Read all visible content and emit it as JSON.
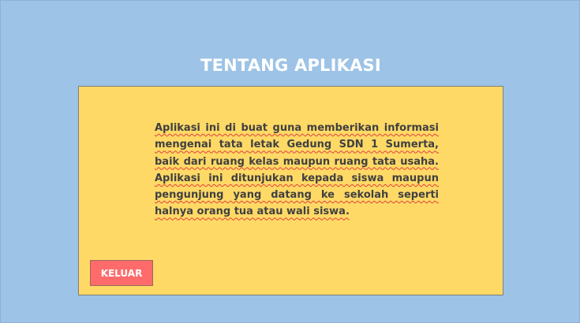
{
  "header": {
    "title": "TENTANG APLIKASI"
  },
  "content": {
    "description": "Aplikasi ini di buat guna memberikan informasi mengenai tata letak Gedung SDN 1 Sumerta, baik dari ruang kelas maupun ruang tata usaha. Aplikasi ini ditunjukan kepada siswa maupun pengunjung yang datang ke sekolah seperti halnya orang tua atau wali siswa."
  },
  "actions": {
    "exit_label": "KELUAR"
  },
  "colors": {
    "background": "#9dc3e6",
    "panel": "#ffd966",
    "button": "#ff6b6b",
    "title_text": "#ffffff",
    "body_text": "#404040"
  }
}
